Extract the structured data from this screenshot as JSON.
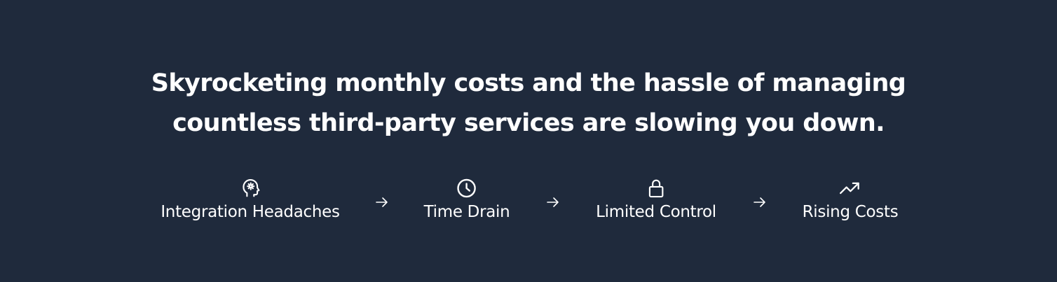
{
  "headline": {
    "line1": "Skyrocketing monthly costs and the hassle of managing",
    "line2": "countless third-party services are slowing you down."
  },
  "steps": [
    {
      "label": "Integration Headaches",
      "icon": "head-gear-icon"
    },
    {
      "label": "Time Drain",
      "icon": "clock-icon"
    },
    {
      "label": "Limited Control",
      "icon": "lock-icon"
    },
    {
      "label": "Rising Costs",
      "icon": "trending-up-icon"
    }
  ],
  "colors": {
    "background": "#1f2a3c",
    "text": "#ffffff"
  }
}
